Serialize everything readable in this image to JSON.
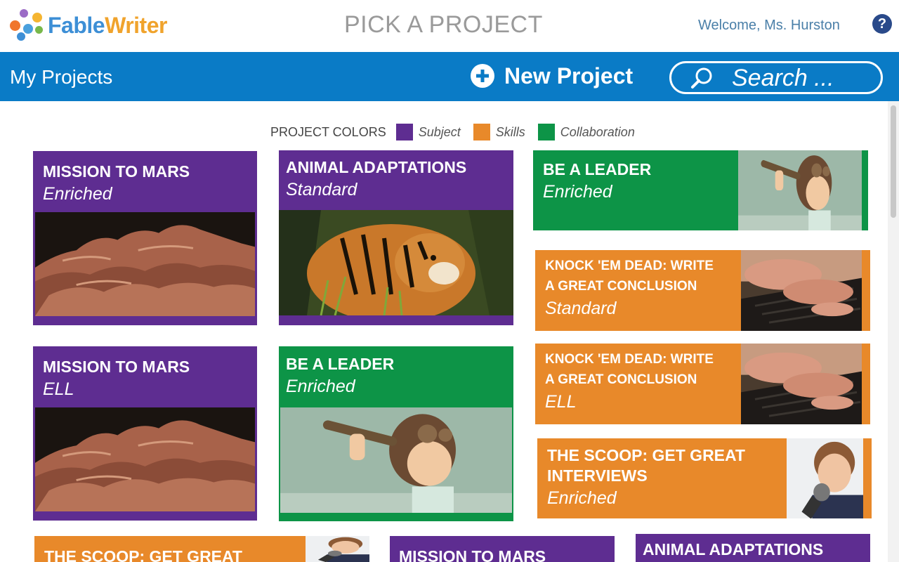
{
  "app": {
    "logo": {
      "part1": "Fable",
      "part2": "Writer"
    },
    "page_title": "PICK A PROJECT",
    "welcome": "Welcome, Ms. Hurston",
    "help_label": "?"
  },
  "nav": {
    "my_projects": "My Projects",
    "new_project": "New Project",
    "search_placeholder": "Search ..."
  },
  "legend": {
    "title": "PROJECT COLORS",
    "items": [
      {
        "label": "Subject",
        "color": "#5e2d91"
      },
      {
        "label": "Skills",
        "color": "#e8892a"
      },
      {
        "label": "Collaboration",
        "color": "#0d9447"
      }
    ]
  },
  "colors": {
    "subject": "#5e2d91",
    "skills": "#e8892a",
    "collaboration": "#0d9447",
    "nav": "#0a7bc6"
  },
  "cards": [
    {
      "title": "MISSION TO MARS",
      "level": "Enriched",
      "image": "mars-terrain",
      "category": "Subject"
    },
    {
      "title": "ANIMAL ADAPTATIONS",
      "level": "Standard",
      "image": "tiger",
      "category": "Subject"
    },
    {
      "title": "BE A LEADER",
      "level": "Enriched",
      "image": "child-with-telescope",
      "category": "Collaboration"
    },
    {
      "title_line1": "KNOCK 'EM DEAD: WRITE",
      "title_line2": "A GREAT CONCLUSION",
      "level": "Standard",
      "image": "hands-typing",
      "category": "Skills"
    },
    {
      "title": "MISSION TO MARS",
      "level": "ELL",
      "image": "mars-terrain",
      "category": "Subject"
    },
    {
      "title": "BE A LEADER",
      "level": "Enriched",
      "image": "child-with-telescope",
      "category": "Collaboration"
    },
    {
      "title_line1": "KNOCK 'EM DEAD: WRITE",
      "title_line2": "A GREAT CONCLUSION",
      "level": "ELL",
      "image": "hands-typing",
      "category": "Skills"
    },
    {
      "title_line1": "THE SCOOP: GET GREAT",
      "title_line2": "INTERVIEWS",
      "level": "Enriched",
      "image": "boy-with-microphone",
      "category": "Skills"
    },
    {
      "title": "THE SCOOP: GET GREAT",
      "image": "boy-with-microphone",
      "category": "Skills"
    },
    {
      "title": "MISSION TO MARS",
      "category": "Subject"
    },
    {
      "title": "ANIMAL ADAPTATIONS",
      "category": "Subject"
    }
  ]
}
